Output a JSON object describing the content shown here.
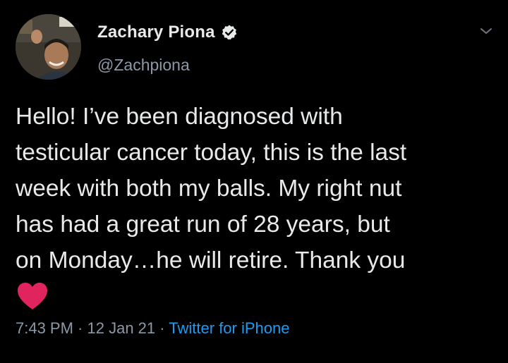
{
  "user": {
    "display_name": "Zachary Piona",
    "handle": "@Zachpiona",
    "verified": true,
    "verified_icon": "verified-badge-icon",
    "avatar_icon": "profile-photo-avatar"
  },
  "menu": {
    "icon": "chevron-down-icon"
  },
  "tweet": {
    "lines": [
      "Hello! I’ve been diagnosed with",
      "testicular cancer today, this is the last",
      "week with both my balls. My right nut",
      "has had a great run of 28 years, but",
      "on Monday…he will retire. Thank you"
    ],
    "emoji": "red-heart-icon"
  },
  "meta": {
    "time": "7:43 PM",
    "separator_1": " · ",
    "date": "12 Jan 21",
    "separator_2": " · ",
    "source": "Twitter for iPhone"
  },
  "colors": {
    "background": "#000000",
    "text": "#e7e9ea",
    "secondary": "#8b98a5",
    "link": "#1d9bf0",
    "heart": "#e0245e"
  }
}
